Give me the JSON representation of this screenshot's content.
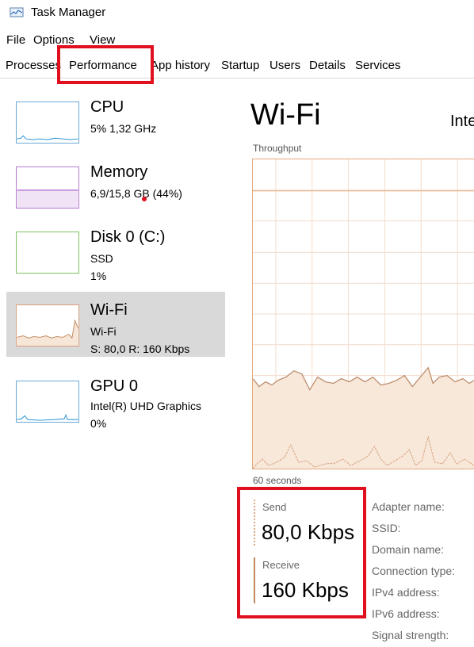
{
  "window": {
    "title": "Task Manager"
  },
  "menu": [
    "File",
    "Options",
    "View"
  ],
  "tabs": [
    "Processes",
    "Performance",
    "App history",
    "Startup",
    "Users",
    "Details",
    "Services"
  ],
  "sidebar": {
    "items": [
      {
        "title": "CPU",
        "sub1": "5%  1,32 GHz",
        "sub2": "",
        "color": "#1e90d6"
      },
      {
        "title": "Memory",
        "sub1": "6,9/15,8 GB (44%)",
        "sub2": "",
        "color": "#9b3fbf"
      },
      {
        "title": "Disk 0 (C:)",
        "sub1": "SSD",
        "sub2": "1%",
        "color": "#4ea72e"
      },
      {
        "title": "Wi-Fi",
        "sub1": "Wi-Fi",
        "sub2": "S: 80,0  R: 160 Kbps",
        "color": "#c2875e"
      },
      {
        "title": "GPU 0",
        "sub1": "Intel(R) UHD Graphics",
        "sub2": "0%",
        "color": "#1e90d6"
      }
    ]
  },
  "main": {
    "title": "Wi-Fi",
    "adapter_short": "Inte",
    "graph_label": "Throughput",
    "time_label": "60 seconds",
    "send_label": "Send",
    "send_value": "80,0 Kbps",
    "receive_label": "Receive",
    "receive_value": "160 Kbps",
    "properties": [
      "Adapter name:",
      "SSID:",
      "Domain name:",
      "Connection type:",
      "IPv4 address:",
      "IPv6 address:",
      "Signal strength:"
    ]
  },
  "colors": {
    "highlight": "#e0101e",
    "wifi": "#c2875e",
    "selected_bg": "#d9d9d9"
  }
}
